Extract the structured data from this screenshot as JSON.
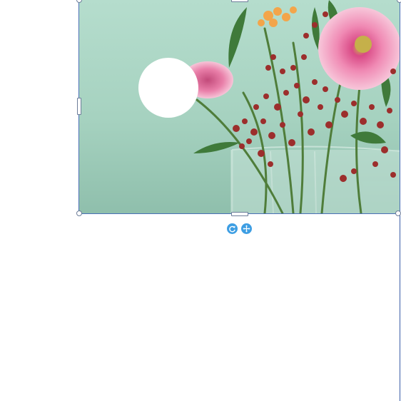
{
  "editor": {
    "selected_object": "image",
    "image_description_icon": "flower-vase-photo",
    "colors": {
      "selection_outline": "#4a6fb5",
      "control_button": "#3d9ee3",
      "photo_background": "#a8d4c3"
    }
  },
  "controls": {
    "rotate_icon": "rotate-icon",
    "move_icon": "move-icon"
  }
}
